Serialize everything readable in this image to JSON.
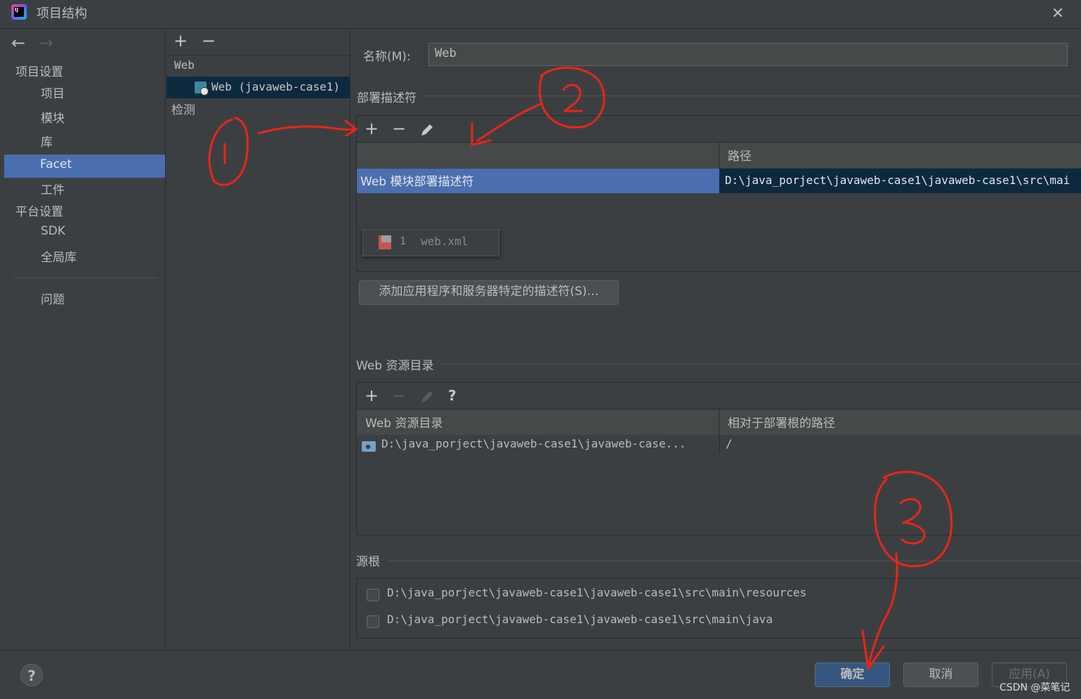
{
  "window": {
    "title": "项目结构",
    "app_icon": "intellij-idea-icon"
  },
  "sidebar": {
    "project_settings_header": "项目设置",
    "project_items": [
      "项目",
      "模块",
      "库",
      "Facet",
      "工件"
    ],
    "platform_settings_header": "平台设置",
    "platform_items": [
      "SDK",
      "全局库"
    ],
    "problems": "问题",
    "selected": "Facet"
  },
  "tree": {
    "group": "Web",
    "item": "Web (javaweb-case1)",
    "detection": "检测"
  },
  "form": {
    "name_label": "名称(M):",
    "name_value": "Web"
  },
  "deployment_descriptors": {
    "section_title": "部署描述符",
    "popup_number": "1",
    "popup_item": "web.xml",
    "path_header": "路径",
    "row_type": "Web 模块部署描述符",
    "row_path": "D:\\java_porject\\javaweb-case1\\javaweb-case1\\src\\mai",
    "add_server_descriptor_button": "添加应用程序和服务器特定的描述符(S)…"
  },
  "web_resources": {
    "section_title": "Web 资源目录",
    "help_icon_label": "?",
    "col_dir": "Web 资源目录",
    "col_relative": "相对于部署根的路径",
    "row_dir": "D:\\java_porject\\javaweb-case1\\javaweb-case...",
    "row_relative": "/"
  },
  "source_roots": {
    "section_title": "源根",
    "items": [
      "D:\\java_porject\\javaweb-case1\\javaweb-case1\\src\\main\\resources",
      "D:\\java_porject\\javaweb-case1\\javaweb-case1\\src\\main\\java"
    ]
  },
  "buttons": {
    "help": "?",
    "ok": "确定",
    "cancel": "取消",
    "apply": "应用(A)"
  },
  "watermark": "CSDN @菜笔记",
  "colors": {
    "background": "#3c3f41",
    "selection": "#4b6eaf",
    "tree_selection": "#0d293e",
    "annotation": "#e8261b",
    "ok_button": "#365880"
  }
}
